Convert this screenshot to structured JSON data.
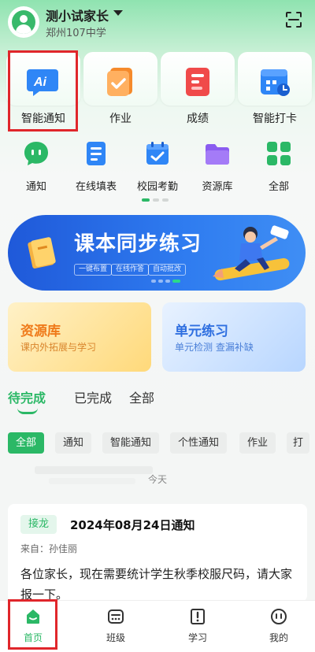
{
  "header": {
    "user_name": "测小试家长",
    "school": "郑州107中学"
  },
  "featured_apps": [
    {
      "label": "智能通知",
      "icon": "ai-notice-icon",
      "color": "#2f86f6"
    },
    {
      "label": "作业",
      "icon": "homework-icon",
      "color": "#f58a2b"
    },
    {
      "label": "成绩",
      "icon": "grades-icon",
      "color": "#f04a4a"
    },
    {
      "label": "智能打卡",
      "icon": "calendar-checkin-icon",
      "color": "#2f86f6"
    }
  ],
  "apps": [
    {
      "label": "通知",
      "icon": "chat-bubble-icon"
    },
    {
      "label": "在线填表",
      "icon": "form-icon"
    },
    {
      "label": "校园考勤",
      "icon": "attendance-calendar-icon"
    },
    {
      "label": "资源库",
      "icon": "folder-icon"
    },
    {
      "label": "全部",
      "icon": "grid-icon"
    }
  ],
  "banner": {
    "title": "课本同步练习",
    "tags": [
      "一键布置",
      "在线作答",
      "自动批改"
    ]
  },
  "resource_cards": [
    {
      "title": "资源库",
      "subtitle": "课内外拓展与学习",
      "title_color": "#ef7a1a"
    },
    {
      "title": "单元练习",
      "subtitle": "单元检测 查漏补缺",
      "title_color": "#2f6fe0"
    }
  ],
  "tabs": [
    "待完成",
    "已完成",
    "全部"
  ],
  "active_tab": "待完成",
  "filters": [
    "全部",
    "通知",
    "智能通知",
    "个性通知",
    "作业",
    "打"
  ],
  "active_filter": "全部",
  "list": {
    "date_divider": "今天",
    "items": [
      {
        "badge": "接龙",
        "title": "2024年08月24日通知",
        "from": "来自：孙佳丽",
        "body": "各位家长，现在需要统计学生秋季校服尺码，请大家报一下。"
      }
    ]
  },
  "bottom_nav": [
    {
      "label": "首页",
      "icon": "home-icon"
    },
    {
      "label": "班级",
      "icon": "class-icon"
    },
    {
      "label": "学习",
      "icon": "study-icon"
    },
    {
      "label": "我的",
      "icon": "profile-icon"
    }
  ],
  "active_nav": "首页",
  "colors": {
    "accent": "#2bb866",
    "highlight": "#e0262b",
    "banner": "#2f7cf0"
  }
}
